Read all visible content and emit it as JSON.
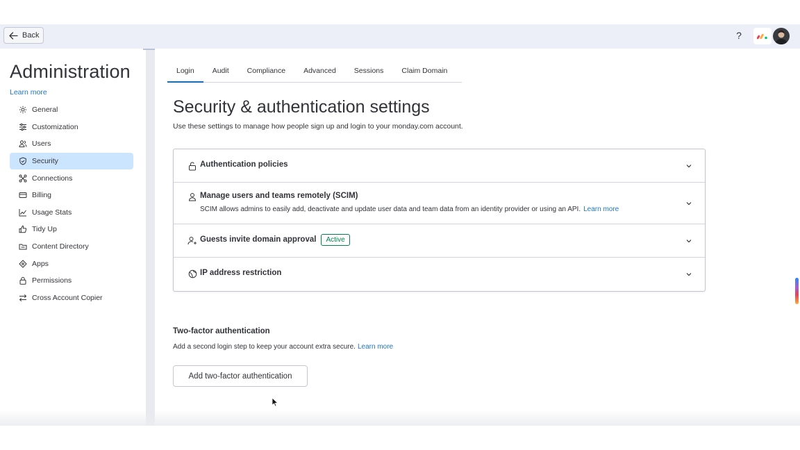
{
  "topbar": {
    "back_label": "Back",
    "help_label": "?"
  },
  "sidebar": {
    "title": "Administration",
    "learn_more": "Learn more",
    "items": [
      {
        "label": "General",
        "icon": "gear-icon"
      },
      {
        "label": "Customization",
        "icon": "sliders-icon"
      },
      {
        "label": "Users",
        "icon": "users-icon"
      },
      {
        "label": "Security",
        "icon": "shield-icon",
        "active": true
      },
      {
        "label": "Connections",
        "icon": "connections-icon"
      },
      {
        "label": "Billing",
        "icon": "credit-card-icon"
      },
      {
        "label": "Usage Stats",
        "icon": "chart-line-icon"
      },
      {
        "label": "Tidy Up",
        "icon": "thumbs-up-icon"
      },
      {
        "label": "Content Directory",
        "icon": "folder-icon"
      },
      {
        "label": "Apps",
        "icon": "puzzle-icon"
      },
      {
        "label": "Permissions",
        "icon": "lock-icon"
      },
      {
        "label": "Cross Account Copier",
        "icon": "arrows-swap-icon"
      }
    ]
  },
  "tabs": [
    {
      "label": "Login",
      "active": true
    },
    {
      "label": "Audit"
    },
    {
      "label": "Compliance"
    },
    {
      "label": "Advanced"
    },
    {
      "label": "Sessions"
    },
    {
      "label": "Claim Domain"
    }
  ],
  "page": {
    "title": "Security & authentication settings",
    "subtitle": "Use these settings to manage how people sign up and login to your monday.com account."
  },
  "accordion": [
    {
      "title": "Authentication policies",
      "icon": "lock-open-icon"
    },
    {
      "title": "Manage users and teams remotely (SCIM)",
      "icon": "person-icon",
      "description": "SCIM allows admins to easily add, deactivate and update user data and team data from an identity provider or using an API.",
      "learn_more": "Learn more"
    },
    {
      "title": "Guests invite domain approval",
      "icon": "person-add-icon",
      "badge": "Active"
    },
    {
      "title": "IP address restriction",
      "icon": "globe-icon"
    }
  ],
  "two_factor": {
    "title": "Two-factor authentication",
    "subtitle": "Add a second login step to keep your account extra secure.",
    "learn_more": "Learn more",
    "button_label": "Add two-factor authentication"
  },
  "colors": {
    "accent": "#0073ea",
    "link": "#1f76c2",
    "active_nav_bg": "#cce5ff",
    "badge_green": "#00854d"
  }
}
